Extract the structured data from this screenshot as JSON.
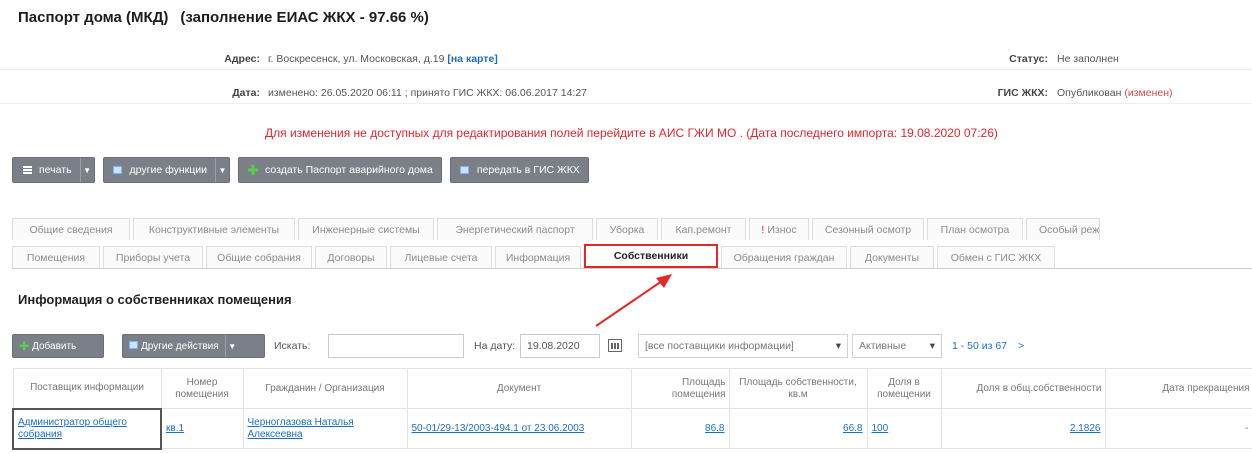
{
  "header": {
    "title": "Паспорт дома  (МКД)",
    "fill_info": "(заполнение ЕИАС ЖКХ - 97.66 %)"
  },
  "address": {
    "label": "Адрес:",
    "value": "г. Воскресенск, ул. Московская, д.19",
    "map_link": "[на карте]"
  },
  "status": {
    "label": "Статус:",
    "value": "Не заполнен"
  },
  "date": {
    "label": "Дата:",
    "value": "изменено: 26.05.2020 06:11 ;   принято ГИС ЖКХ: 06.06.2017 14:27"
  },
  "gis": {
    "label": "ГИС ЖКХ:",
    "value": "Опубликован",
    "changed": "(изменен)"
  },
  "warning": "Для изменения не доступных для редактирования полей перейдите в АИС ГЖИ МО . (Дата последнего импорта: 19.08.2020 07:26)",
  "toolbar": {
    "print": "печать",
    "other_functions": "другие функции",
    "create_passport": "создать Паспорт аварийного дома",
    "send_gis": "передать в ГИС ЖКХ"
  },
  "tabs_row1": [
    "Общие сведения",
    "Конструктивные элементы",
    "Инженерные системы",
    "Энергетический паспорт",
    "Уборка",
    "Кап.ремонт",
    "! Износ",
    "Сезонный осмотр",
    "План осмотра",
    "Особый режим"
  ],
  "tabs_row2": [
    "Помещения",
    "Приборы учета",
    "Общие собрания",
    "Договоры",
    "Лицевые счета",
    "Информация",
    "Собственники",
    "Обращения граждан",
    "Документы",
    "Обмен с ГИС ЖКХ"
  ],
  "section_title": "Информация о собственниках помещения",
  "filters": {
    "add": "Добавить",
    "other_actions": "Другие действия",
    "search_label": "Искать:",
    "search_value": "",
    "date_label": "На дату:",
    "date_value": "19.08.2020",
    "supplier_select": "[все поставщики информации]",
    "active_select": "Активные",
    "pager": "1 - 50 из 67",
    "pager_next": ">"
  },
  "table": {
    "columns": [
      "Поставщик информации",
      "Номер помещения",
      "Гражданин / Организация",
      "Документ",
      "Площадь помещения",
      "Площадь собственности, кв.м",
      "Доля в помещении",
      "Доля в общ.собственности",
      "Дата прекращения"
    ],
    "rows": [
      {
        "supplier": "Администратор общего собрания",
        "room": "кв.1",
        "owner": "Черноглазова Наталья Алексеевна",
        "document": "50-01/29-13/2003-494.1 от 23.06.2003",
        "room_area": "86.8",
        "own_area": "66.8",
        "share_room": "100",
        "share_common": "2.1826",
        "end_date": "-"
      }
    ]
  },
  "colors": {
    "accent_red": "#e02a2a",
    "link_blue": "#1a6fc4",
    "button_gray": "#7b8088"
  }
}
